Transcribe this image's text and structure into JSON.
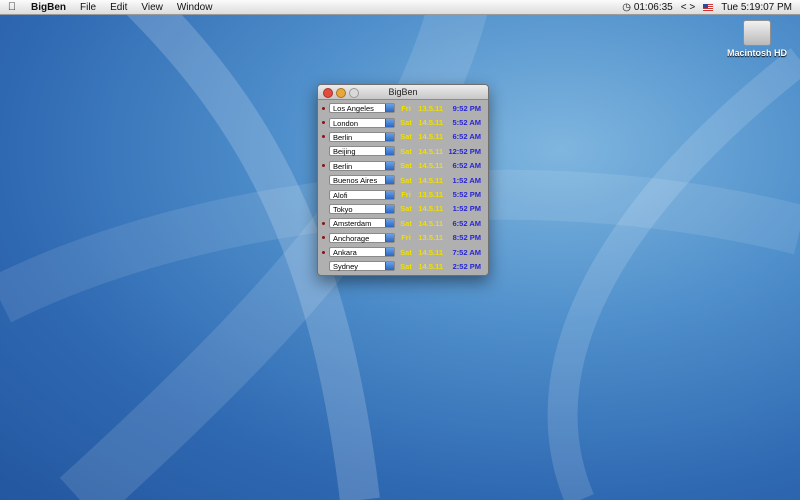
{
  "menubar": {
    "apple_icon": "apple-logo",
    "app_name": "BigBen",
    "menus": [
      "File",
      "Edit",
      "View",
      "Window"
    ],
    "clock_extra": "01:06:35",
    "nav_label": "<  >",
    "date_time": "Tue 5:19:07 PM"
  },
  "desktop": {
    "drive_label": "Macintosh HD"
  },
  "window": {
    "title": "BigBen",
    "rows": [
      {
        "marked": true,
        "city": "Los Angeles",
        "day": "Fri",
        "date": "13.5.11",
        "time": "9:52  PM"
      },
      {
        "marked": true,
        "city": "London",
        "day": "Sat",
        "date": "14.5.11",
        "time": "5:52  AM"
      },
      {
        "marked": true,
        "city": "Berlin",
        "day": "Sat",
        "date": "14.5.11",
        "time": "6:52  AM"
      },
      {
        "marked": false,
        "city": "Beijing",
        "day": "Sat",
        "date": "14.5.11",
        "time": "12:52 PM"
      },
      {
        "marked": true,
        "city": "Berlin",
        "day": "Sat",
        "date": "14.5.11",
        "time": "6:52  AM"
      },
      {
        "marked": false,
        "city": "Buenos Aires",
        "day": "Sat",
        "date": "14.5.11",
        "time": "1:52  AM"
      },
      {
        "marked": false,
        "city": "Alofi",
        "day": "Fri",
        "date": "13.5.11",
        "time": "5:52  PM"
      },
      {
        "marked": false,
        "city": "Tokyo",
        "day": "Sat",
        "date": "14.5.11",
        "time": "1:52  PM"
      },
      {
        "marked": true,
        "city": "Amsterdam",
        "day": "Sat",
        "date": "14.5.11",
        "time": "6:52  AM"
      },
      {
        "marked": true,
        "city": "Anchorage",
        "day": "Fri",
        "date": "13.5.11",
        "time": "8:52  PM"
      },
      {
        "marked": true,
        "city": "Ankara",
        "day": "Sat",
        "date": "14.5.11",
        "time": "7:52  AM"
      },
      {
        "marked": false,
        "city": "Sydney",
        "day": "Sat",
        "date": "14.5.11",
        "time": "2:52  PM"
      }
    ]
  },
  "colors": {
    "day_date": "#f0e000",
    "time": "#2626d6",
    "marker": "#8a1414"
  }
}
